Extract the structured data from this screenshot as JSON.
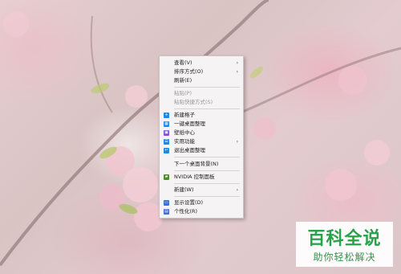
{
  "menu": {
    "items": [
      {
        "label": "查看(V)"
      },
      {
        "label": "排序方式(O)"
      },
      {
        "label": "刷新(E)"
      },
      {
        "label": "粘贴(P)"
      },
      {
        "label": "粘贴快捷方式(S)"
      },
      {
        "label": "新建格子"
      },
      {
        "label": "一键桌面整理"
      },
      {
        "label": "壁纸中心"
      },
      {
        "label": "实用功能"
      },
      {
        "label": "退出桌面整理"
      },
      {
        "label": "下一个桌面背景(N)"
      },
      {
        "label": "NVIDIA 控制面板"
      },
      {
        "label": "新建(W)"
      },
      {
        "label": "显示设置(D)"
      },
      {
        "label": "个性化(R)"
      }
    ],
    "submenu_arrow": "›"
  },
  "icons": {
    "new_grid": {
      "name": "plus-icon",
      "glyph": "+",
      "color": "#1e88e5"
    },
    "organize": {
      "name": "grid-icon",
      "glyph": "▦",
      "color": "#1e88e5"
    },
    "wallpaper": {
      "name": "wallpaper-icon",
      "glyph": "▣",
      "color": "#7b4fd6"
    },
    "utility": {
      "name": "apps-icon",
      "glyph": "☰",
      "color": "#1e88e5"
    },
    "exit": {
      "name": "exit-icon",
      "glyph": "↩",
      "color": "#1e88e5"
    },
    "nvidia": {
      "name": "nvidia-icon",
      "glyph": "▰",
      "color": "#4a8f2a"
    },
    "display": {
      "name": "display-icon",
      "glyph": "▭",
      "color": "#3b6fd0"
    },
    "personalize": {
      "name": "personalize-icon",
      "glyph": "▤",
      "color": "#3b6fd0"
    }
  },
  "watermark": {
    "title": "百科全说",
    "subtitle": "助你轻松解决"
  }
}
